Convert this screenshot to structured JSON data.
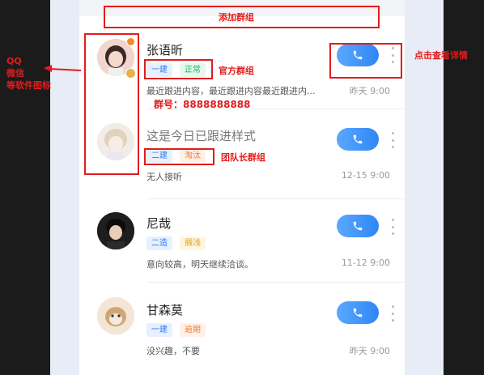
{
  "annotations": {
    "add_group": "添加群组",
    "official_group": "官方群组",
    "group_number": "群号：8888888888",
    "team_leader_group": "团队长群组",
    "click_details": "点击查看详情",
    "left_qq": "QQ",
    "left_wechat": "微信",
    "left_icons": "等软件图标"
  },
  "contacts": [
    {
      "name": "张语昕",
      "tags": [
        "一建",
        "正常"
      ],
      "note": "最近跟进内容，最近跟进内容最近跟进内...",
      "time": "昨天 9:00",
      "name_style": "dark"
    },
    {
      "name": "这是今日已跟进样式",
      "tags": [
        "二建",
        "淘汰"
      ],
      "note": "无人接听",
      "time": "12-15 9:00",
      "name_style": "gray"
    },
    {
      "name": "尼哉",
      "tags": [
        "二造",
        "搁浅"
      ],
      "note": "意向较高，明天继续洽谈。",
      "time": "11-12 9:00",
      "name_style": "dark"
    },
    {
      "name": "甘森莫",
      "tags": [
        "一建",
        "逾期"
      ],
      "note": "没兴趣，不要",
      "time": "昨天 9:00",
      "name_style": "dark"
    }
  ],
  "colors": {
    "accent": "#2f86f5",
    "annotation": "#e21c1c"
  },
  "icons": {
    "call": "phone-icon",
    "more": "more-vertical-icon",
    "badge_orange": "status-dot",
    "badge_gold": "verified-badge"
  }
}
